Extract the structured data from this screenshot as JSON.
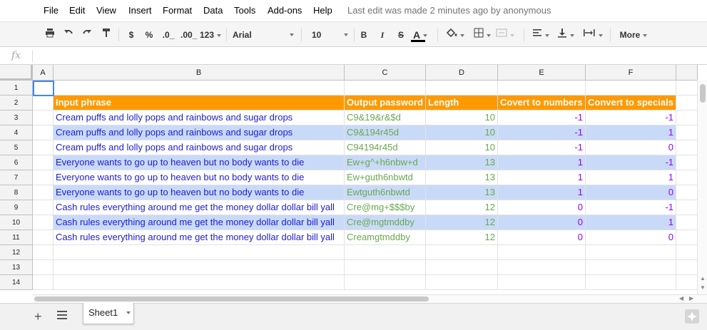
{
  "menu": {
    "items": [
      "File",
      "Edit",
      "View",
      "Insert",
      "Format",
      "Data",
      "Tools",
      "Add-ons",
      "Help"
    ],
    "last_edit": "Last edit was made 2 minutes ago by anonymous"
  },
  "toolbar": {
    "print_icon": "print-icon",
    "currency": "$",
    "percent": "%",
    "decrease_decimals": ".0_",
    "increase_decimals": ".00_",
    "more_formats": "123",
    "font": "Arial",
    "font_size": "10",
    "bold": "B",
    "italic": "I",
    "strike": "S",
    "text_color": "A",
    "more": "More"
  },
  "formula_bar": {
    "fx": "fx",
    "value": ""
  },
  "columns": [
    "A",
    "B",
    "C",
    "D",
    "E",
    "F"
  ],
  "rows": [
    "1",
    "2",
    "3",
    "4",
    "5",
    "6",
    "7",
    "8",
    "9",
    "10",
    "11",
    "12",
    "13",
    "14"
  ],
  "header_row": {
    "input": "Input phrase",
    "output": "Output password",
    "length": "Length",
    "numbers": "Covert to numbers",
    "specials": "Convert to specials"
  },
  "data_rows": [
    {
      "input": "Cream puffs and lolly pops and rainbows and sugar drops",
      "output": "C9&19&r&$d",
      "length": "10",
      "numbers": "-1",
      "specials": "-1",
      "highlight": false
    },
    {
      "input": "Cream puffs and lolly pops and rainbows and sugar drops",
      "output": "C9&194r45d",
      "length": "10",
      "numbers": "-1",
      "specials": "1",
      "highlight": true
    },
    {
      "input": "Cream puffs and lolly pops and rainbows and sugar drops",
      "output": "C94194r45d",
      "length": "10",
      "numbers": "-1",
      "specials": "0",
      "highlight": false
    },
    {
      "input": "Everyone wants to go up to heaven but no body wants to die",
      "output": "Ew+g^+h6nbw+d",
      "length": "13",
      "numbers": "1",
      "specials": "-1",
      "highlight": true
    },
    {
      "input": "Everyone wants to go up to heaven but no body wants to die",
      "output": "Ew+guth6nbwtd",
      "length": "13",
      "numbers": "1",
      "specials": "1",
      "highlight": false
    },
    {
      "input": "Everyone wants to go up to heaven but no body wants to die",
      "output": "Ewtguth6nbwtd",
      "length": "13",
      "numbers": "1",
      "specials": "0",
      "highlight": true
    },
    {
      "input": "Cash rules everything around me get the money dollar dollar bill yall",
      "output": "Cre@mg+$$$by",
      "length": "12",
      "numbers": "0",
      "specials": "-1",
      "highlight": false
    },
    {
      "input": "Cash rules everything around me get the money dollar dollar bill yall",
      "output": "Cre@mgtmddby",
      "length": "12",
      "numbers": "0",
      "specials": "1",
      "highlight": true
    },
    {
      "input": "Cash rules everything around me get the money dollar dollar bill yall",
      "output": "Creamgtmddby",
      "length": "12",
      "numbers": "0",
      "specials": "0",
      "highlight": false
    }
  ],
  "sheets": {
    "add": "+",
    "active": "Sheet1"
  },
  "colors": {
    "header_bg": "#ff9900",
    "highlight_bg": "#c9daf8",
    "input_text": "#1c1cd8",
    "output_text": "#6aa84f",
    "number_text": "#9900ff"
  }
}
